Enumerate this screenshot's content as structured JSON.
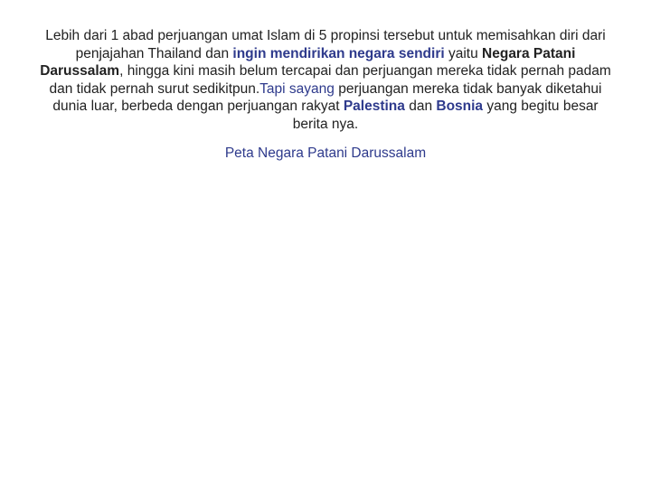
{
  "document": {
    "paragraph": {
      "seg1": "Lebih dari 1 abad perjuangan umat Islam di 5 propinsi tersebut untuk memisahkan diri dari penjajahan Thailand dan ",
      "seg2": "ingin mendirikan negara sendiri",
      "seg3": " yaitu ",
      "seg4": "Negara Patani Darussalam",
      "seg5": ", hingga kini masih belum tercapai dan perjuangan mereka tidak pernah padam dan tidak pernah surut sedikitpun.",
      "seg6": "Tapi sayang",
      "seg7": " perjuangan mereka tidak banyak diketahui dunia luar, berbeda dengan perjuangan rakyat ",
      "seg8": "Palestina",
      "seg9": " dan ",
      "seg10": "Bosnia",
      "seg11": " yang begitu besar berita nya."
    },
    "caption": "Peta Negara Patani Darussalam"
  },
  "colors": {
    "text": "#222222",
    "accent": "#2e3a8c"
  }
}
